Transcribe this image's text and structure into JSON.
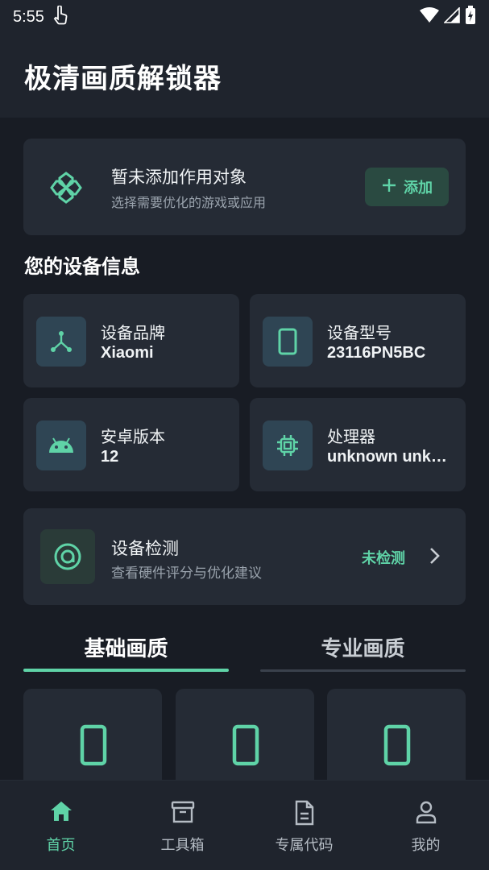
{
  "status_bar": {
    "time": "5:55",
    "icons": [
      "touch-icon",
      "wifi-icon",
      "signal-icon",
      "battery-charging-icon"
    ]
  },
  "header": {
    "title": "极清画质解锁器"
  },
  "target_card": {
    "title": "暂未添加作用对象",
    "subtitle": "选择需要优化的游戏或应用",
    "add_button": "添加",
    "icon": "gamepad-icon"
  },
  "device_section": {
    "title": "您的设备信息",
    "items": [
      {
        "label": "设备品牌",
        "value": "Xiaomi",
        "icon": "brand-icon"
      },
      {
        "label": "设备型号",
        "value": "23116PN5BC",
        "icon": "phone-icon"
      },
      {
        "label": "安卓版本",
        "value": "12",
        "icon": "android-icon"
      },
      {
        "label": "处理器",
        "value": "unknown unknown",
        "icon": "chip-icon"
      }
    ]
  },
  "detect_card": {
    "title": "设备检测",
    "subtitle": "查看硬件评分与优化建议",
    "status": "未检测",
    "icon": "scan-icon"
  },
  "tabs": [
    {
      "label": "基础画质",
      "active": true
    },
    {
      "label": "专业画质",
      "active": false
    }
  ],
  "quality_cards": [
    {
      "icon": "phone-icon"
    },
    {
      "icon": "phone-icon"
    },
    {
      "icon": "phone-icon"
    }
  ],
  "bottom_nav": [
    {
      "label": "首页",
      "icon": "home-icon",
      "active": true
    },
    {
      "label": "工具箱",
      "icon": "archive-icon",
      "active": false
    },
    {
      "label": "专属代码",
      "icon": "document-icon",
      "active": false
    },
    {
      "label": "我的",
      "icon": "person-icon",
      "active": false
    }
  ],
  "colors": {
    "accent": "#5fd3a7",
    "background": "#181c24",
    "card": "#252b35",
    "header": "#1f242d"
  }
}
